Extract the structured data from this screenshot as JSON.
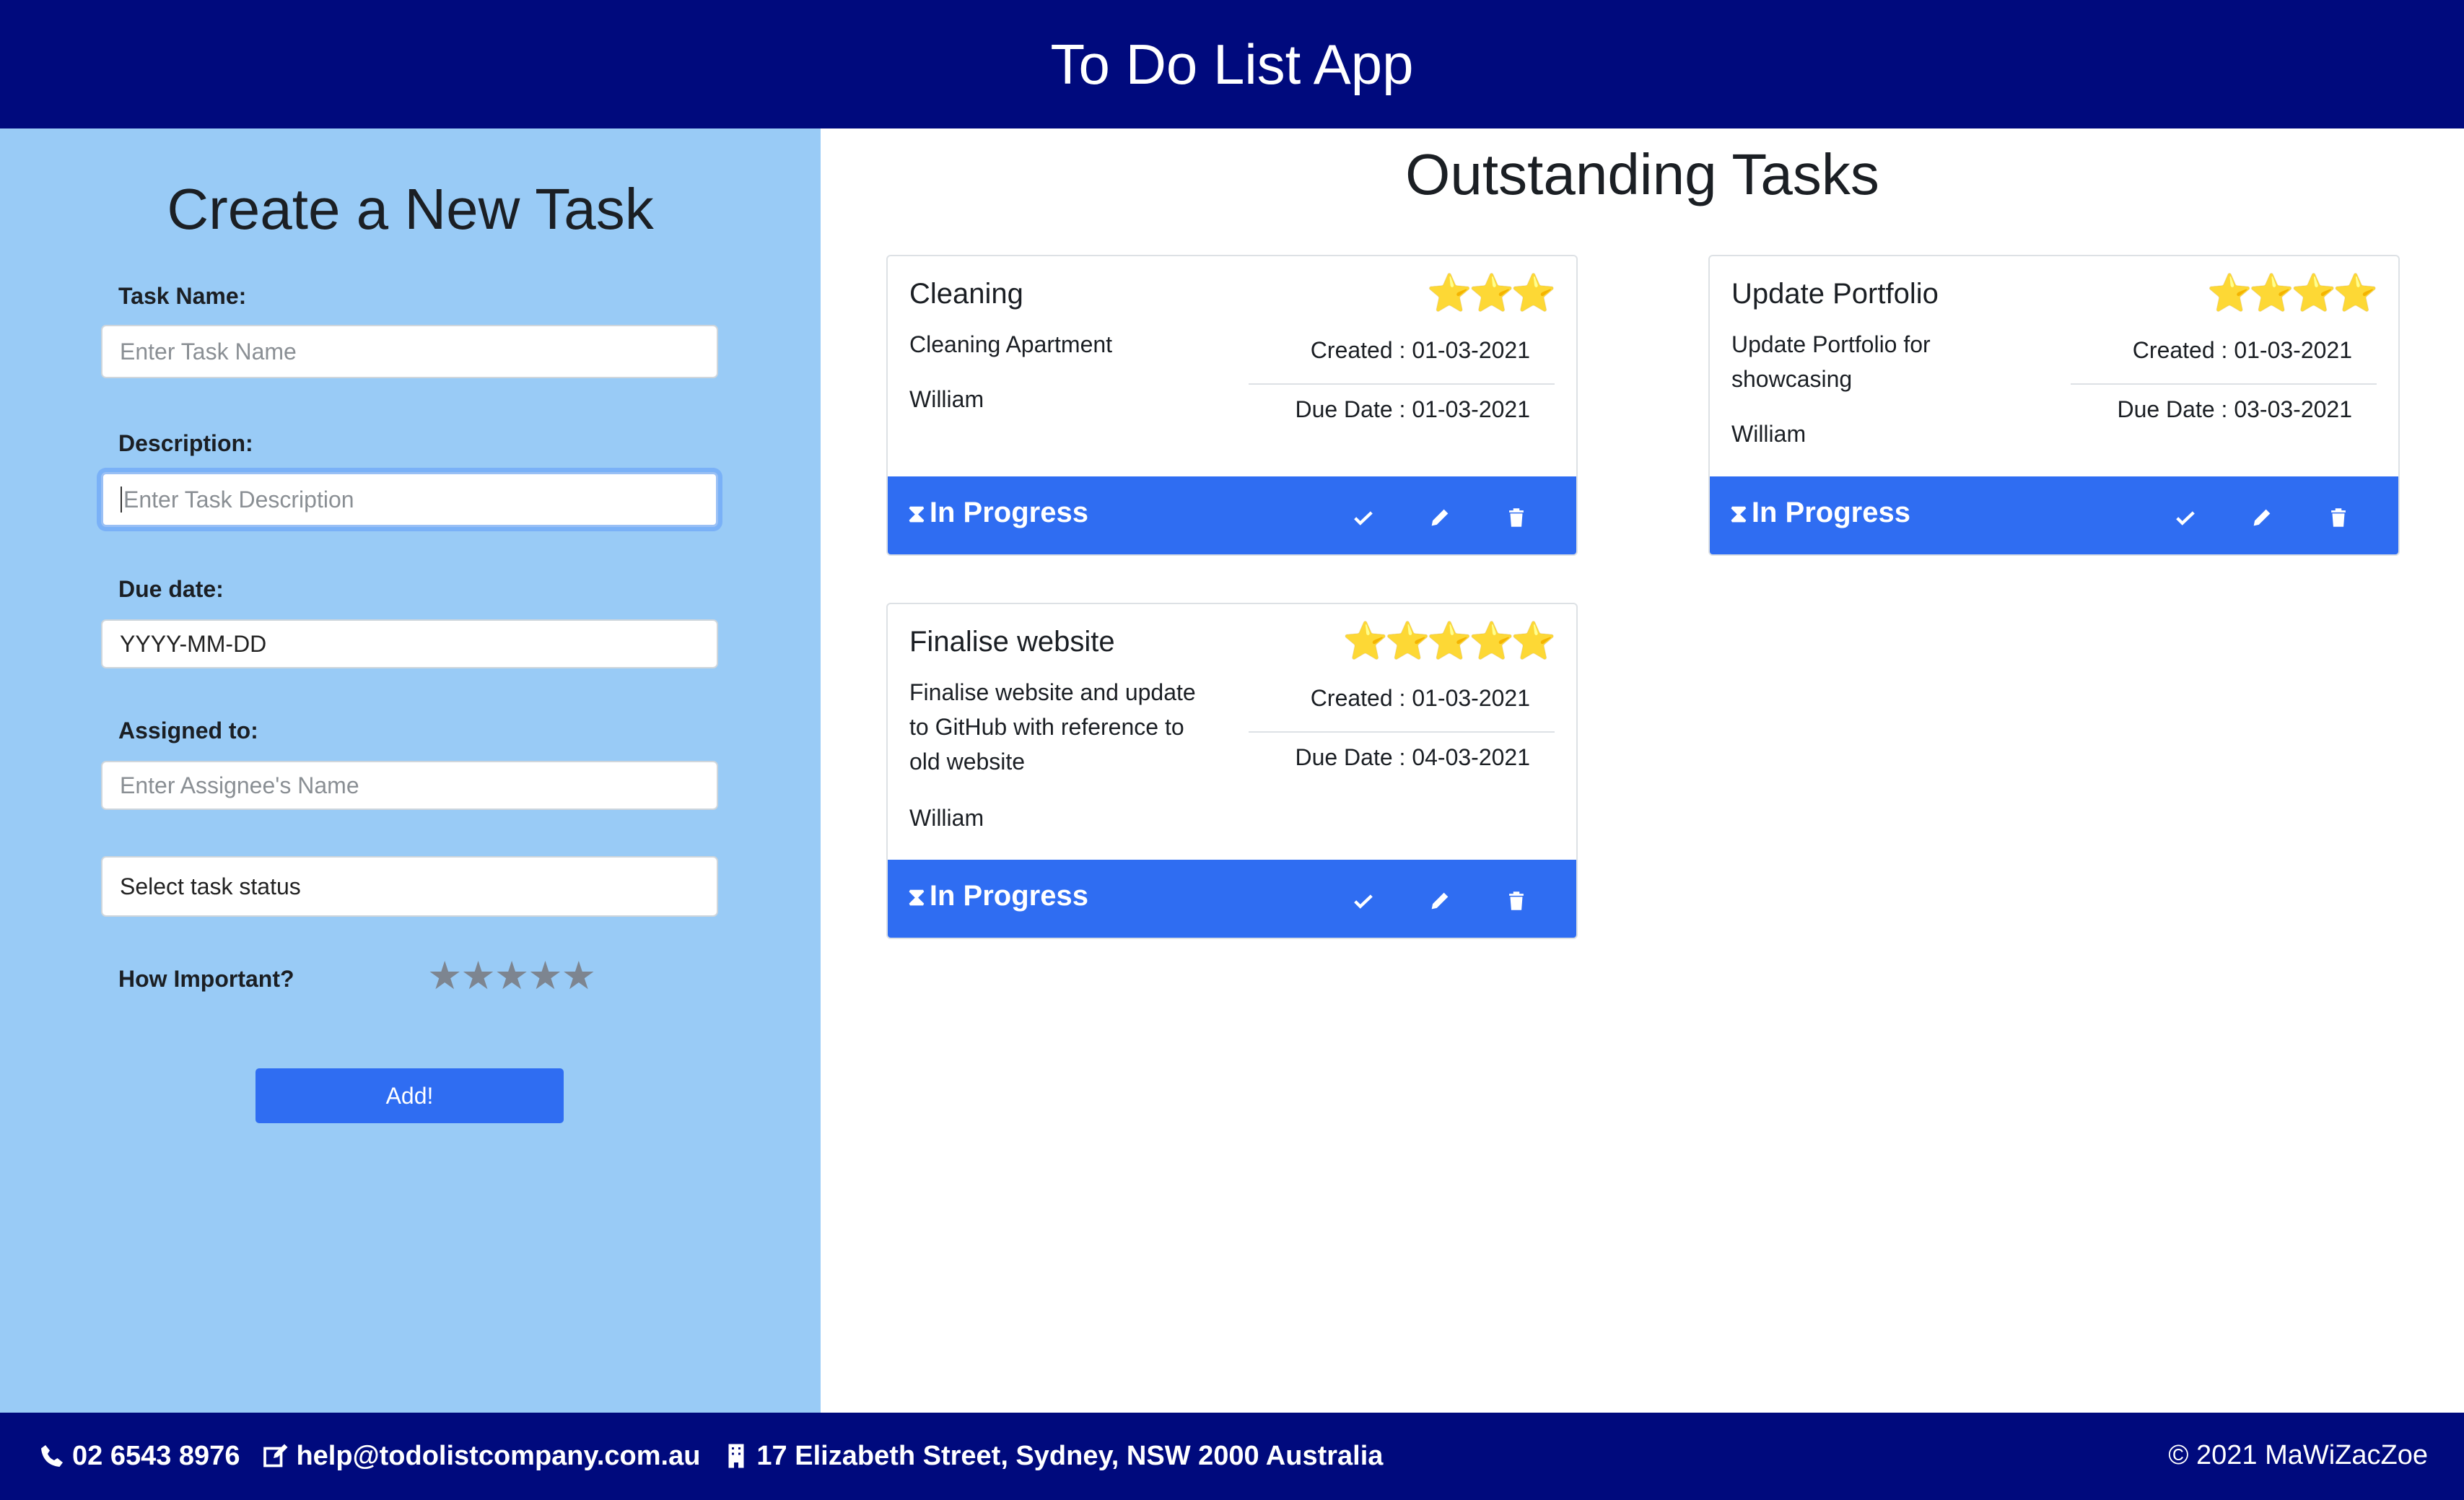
{
  "header": {
    "title": "To Do List App"
  },
  "form": {
    "heading": "Create a New Task",
    "task_name_label": "Task Name:",
    "task_name_placeholder": "Enter Task Name",
    "description_label": "Description:",
    "description_placeholder": "Enter Task Description",
    "due_date_label": "Due date:",
    "due_date_value": "YYYY-MM-DD",
    "assigned_label": "Assigned to:",
    "assigned_placeholder": "Enter Assignee's Name",
    "status_select": "Select task status",
    "importance_label": "How Important?",
    "importance_stars": "★★★★★",
    "add_button": "Add!"
  },
  "main": {
    "heading": "Outstanding Tasks",
    "tasks": [
      {
        "title": "Cleaning",
        "stars": "⭐⭐⭐",
        "description": "Cleaning Apartment",
        "assignee": "William",
        "created": "Created : 01-03-2021",
        "due": "Due Date : 01-03-2021",
        "status": "In Progress"
      },
      {
        "title": "Update Portfolio",
        "stars": "⭐⭐⭐⭐",
        "description": "Update Portfolio for showcasing",
        "assignee": "William",
        "created": "Created : 01-03-2021",
        "due": "Due Date : 03-03-2021",
        "status": "In Progress"
      },
      {
        "title": "Finalise website",
        "stars": "⭐⭐⭐⭐⭐",
        "description": "Finalise website and update to GitHub with reference to old website",
        "assignee": "William",
        "created": "Created : 01-03-2021",
        "due": "Due Date : 04-03-2021",
        "status": "In Progress"
      }
    ]
  },
  "footer": {
    "phone": "02 6543 8976",
    "email": "help@todolistcompany.com.au",
    "address": "17 Elizabeth Street, Sydney, NSW 2000 Australia",
    "copyright": "© 2021 MaWiZacZoe"
  },
  "colors": {
    "header_bg": "#000a7d",
    "sidebar_bg": "#99cbf6",
    "accent": "#2f6df2"
  }
}
